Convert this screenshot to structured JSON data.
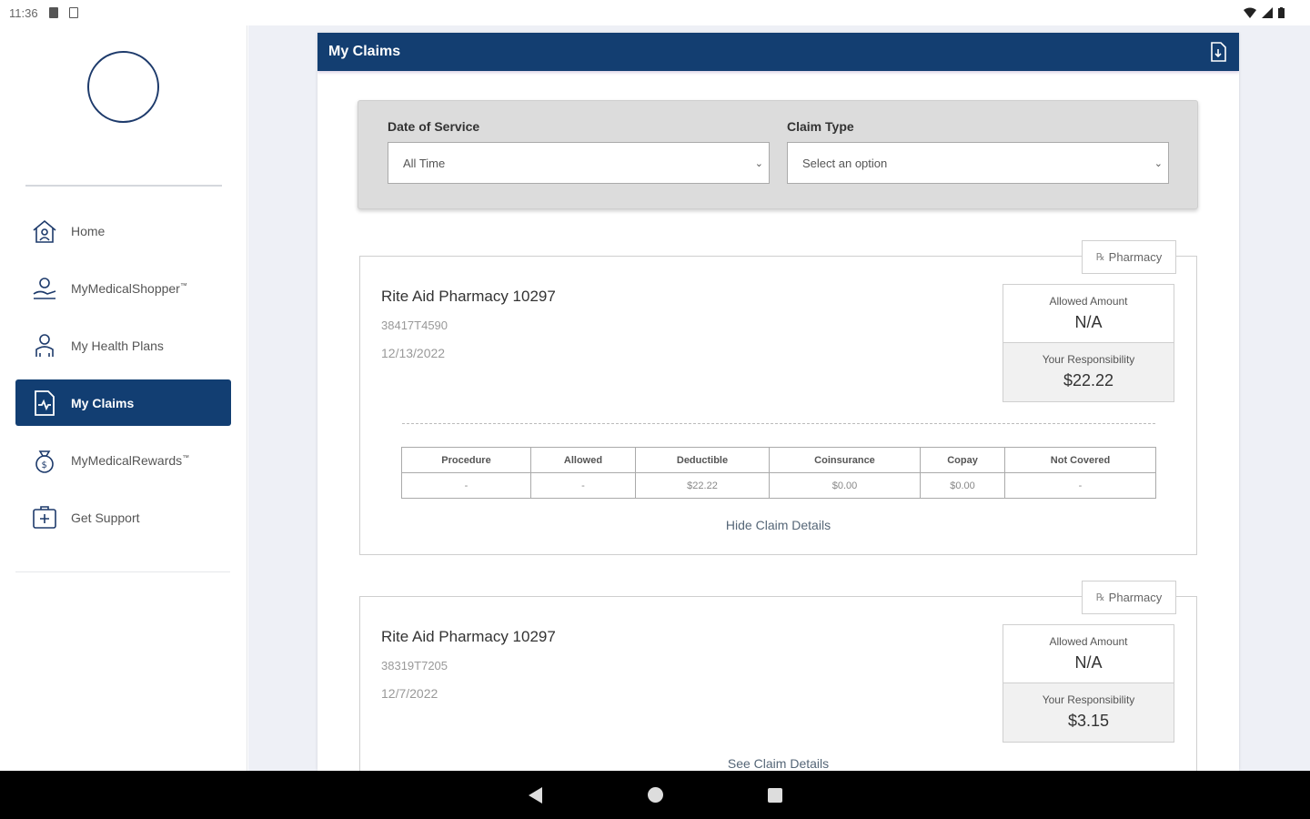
{
  "status_bar": {
    "time": "11:36"
  },
  "sidebar": {
    "items": [
      {
        "label": "Home",
        "icon": "home-icon",
        "active": false
      },
      {
        "label": "MyMedicalShopper",
        "sup": "™",
        "icon": "shopper-icon",
        "active": false
      },
      {
        "label": "My Health Plans",
        "icon": "health-plans-icon",
        "active": false
      },
      {
        "label": "My Claims",
        "icon": "claims-icon",
        "active": true
      },
      {
        "label": "MyMedicalRewards",
        "sup": "™",
        "icon": "rewards-icon",
        "active": false
      },
      {
        "label": "Get Support",
        "icon": "support-icon",
        "active": false
      }
    ]
  },
  "panel": {
    "title": "My Claims",
    "filters": {
      "date_label": "Date of Service",
      "date_value": "All Time",
      "type_label": "Claim Type",
      "type_value": "Select an option"
    }
  },
  "claims": [
    {
      "tag": "Pharmacy",
      "tag_prefix": "℞",
      "title": "Rite Aid Pharmacy 10297",
      "id": "38417T4590",
      "date": "12/13/2022",
      "allowed_label": "Allowed Amount",
      "allowed_value": "N/A",
      "resp_label": "Your Responsibility",
      "resp_value": "$22.22",
      "table": {
        "headers": [
          "Procedure",
          "Allowed",
          "Deductible",
          "Coinsurance",
          "Copay",
          "Not Covered"
        ],
        "row": [
          "-",
          "-",
          "$22.22",
          "$0.00",
          "$0.00",
          "-"
        ]
      },
      "link": "Hide Claim Details"
    },
    {
      "tag": "Pharmacy",
      "tag_prefix": "℞",
      "title": "Rite Aid Pharmacy 10297",
      "id": "38319T7205",
      "date": "12/7/2022",
      "allowed_label": "Allowed Amount",
      "allowed_value": "N/A",
      "resp_label": "Your Responsibility",
      "resp_value": "$3.15",
      "link": "See Claim Details"
    }
  ],
  "colors": {
    "brand_navy": "#133e71",
    "main_bg": "#eef0f6",
    "filter_bg": "#dcdcdc"
  }
}
